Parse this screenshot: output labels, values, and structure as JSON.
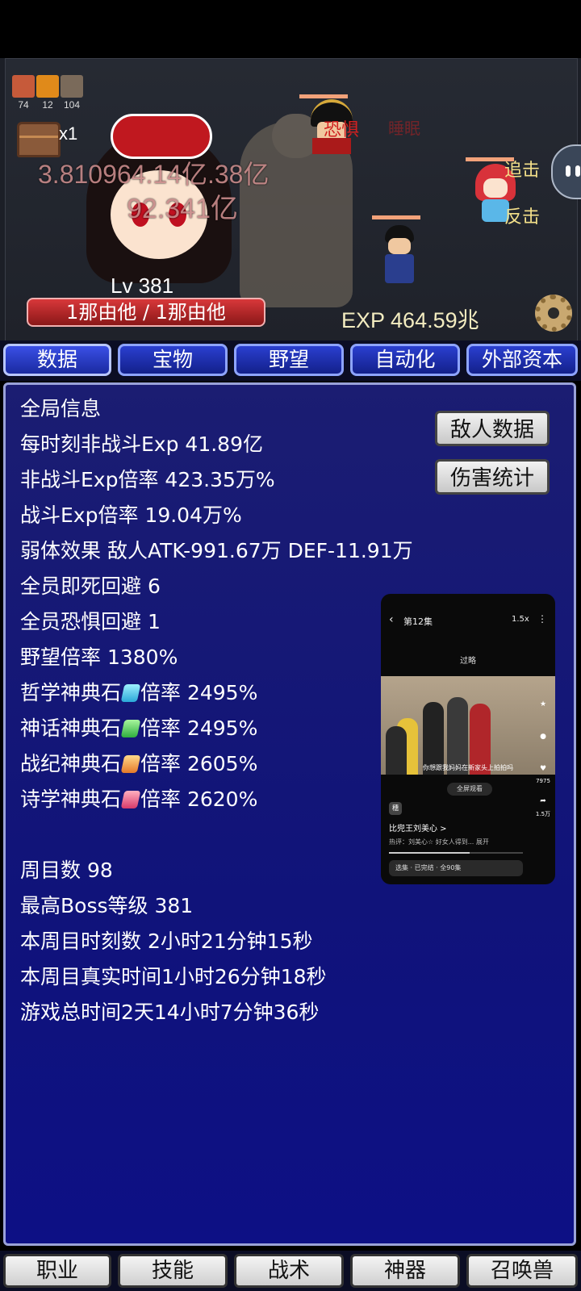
{
  "battle": {
    "resources": [
      {
        "icon": "demon-face-icon",
        "count": "74",
        "color": "#c65a3a"
      },
      {
        "icon": "fire-orb-icon",
        "count": "12",
        "color": "#e08a1a"
      },
      {
        "icon": "skull-icon",
        "count": "104",
        "color": "#7a6a5a"
      }
    ],
    "chest_multiplier": "x1",
    "damage_numbers": [
      "3.810964.14亿.38亿",
      "92.341亿"
    ],
    "enemy_status": {
      "fear": "恐惧",
      "sleep": "睡眠",
      "pursuit": "追击",
      "counter": "反击"
    },
    "level": "Lv 381",
    "hp": "1那由他 / 1那由他",
    "exp": "EXP 464.59兆"
  },
  "tabs": [
    "数据",
    "宝物",
    "野望",
    "自动化",
    "外部资本"
  ],
  "stats": {
    "title": "全局信息",
    "lines": [
      "每时刻非战斗Exp 41.89亿",
      "非战斗Exp倍率 423.35万%",
      "战斗Exp倍率 19.04万%",
      "弱体效果 敌人ATK-991.67万 DEF-11.91万",
      "全员即死回避 6",
      "全员恐惧回避 1",
      "野望倍率 1380%"
    ],
    "gems": [
      {
        "prefix": "哲学神典石",
        "suffix": "倍率 2495%",
        "color": "#45c8e8"
      },
      {
        "prefix": "神话神典石",
        "suffix": "倍率 2495%",
        "color": "#4ccf5a"
      },
      {
        "prefix": "战纪神典石",
        "suffix": "倍率 2605%",
        "color": "#f0a83a"
      },
      {
        "prefix": "诗学神典石",
        "suffix": "倍率 2620%",
        "color": "#e45a7a"
      }
    ],
    "lines2": [
      "周目数 98",
      "最高Boss等级 381",
      "本周目时刻数 2小时21分钟15秒",
      "本周目真实时间1小时26分钟18秒",
      "游戏总时间2天14小时7分钟36秒"
    ],
    "buttons": {
      "enemy_data": "敌人数据",
      "damage_stats": "伤害统计"
    }
  },
  "video": {
    "episode": "第12集",
    "speed": "1.5x",
    "skip": "过略",
    "subtitle": "你想跟我妈妈在新家头上拍拍吗",
    "fullscreen": "全屏观看",
    "likes": "7975",
    "shares": "1.5万",
    "avatar_text": "穗",
    "name": "比兜王刘美心 >",
    "comment": "热评：刘美心☆ 好女人得到...     展开",
    "episodes": "选集 · 已完结 · 全90集"
  },
  "bottom_tabs": [
    "职业",
    "技能",
    "战术",
    "神器",
    "召唤兽"
  ]
}
